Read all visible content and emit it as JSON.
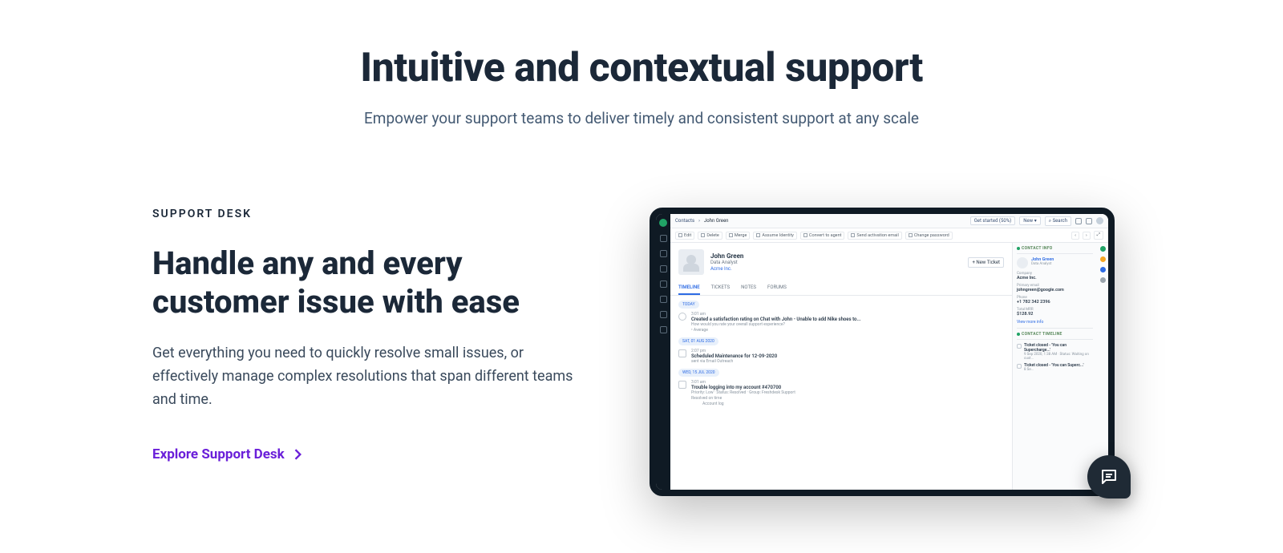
{
  "hero": {
    "title": "Intuitive and contextual support",
    "subtitle": "Empower your support teams to deliver timely and consistent support at any scale"
  },
  "section": {
    "eyebrow": "SUPPORT DESK",
    "heading": "Handle any and every customer issue with ease",
    "body": "Get everything you need to quickly resolve small issues, or effectively manage complex resolutions that span different teams and time.",
    "cta_label": "Explore Support Desk"
  },
  "app": {
    "breadcrumb": {
      "root": "Contacts",
      "current": "John Green"
    },
    "topbar": {
      "get_started": "Get started (50%)",
      "new_btn": "New",
      "search": "Search"
    },
    "actions": [
      "Edit",
      "Delete",
      "Merge",
      "Assume Identity",
      "Convert to agent",
      "Send activation email",
      "Change password"
    ],
    "profile": {
      "name": "John Green",
      "role": "Data Analyst",
      "company": "Acme Inc.",
      "new_ticket_btn": "+ New Ticket"
    },
    "tabs": [
      "TIMELINE",
      "TICKETS",
      "NOTES",
      "FORUMS"
    ],
    "feed": [
      {
        "date": "TODAY",
        "items": [
          {
            "time": "3:01 am",
            "title": "Created a satisfaction rating on Chat with John - Unable to add Nike shoes to...",
            "sub": "How would you rate your overall support experience?",
            "meta": "• Average"
          }
        ]
      },
      {
        "date": "SAT, 01 AUG 2020",
        "items": [
          {
            "time": "2:07 pm",
            "title": "Scheduled Maintenance for 12-09-2020",
            "sub": "sent via Email Outreach"
          }
        ]
      },
      {
        "date": "WED, 15 JUL 2020",
        "items": [
          {
            "time": "3:01 am",
            "title": "Trouble logging into my account #470700",
            "sub": "Priority: Low · Status: Resolved · Group: Freshdesk Support",
            "meta": "Resolved on time",
            "extra": "Account log"
          }
        ]
      }
    ],
    "contact_info": {
      "title": "CONTACT INFO",
      "name": "John Green",
      "role": "Data Analyst",
      "company_label": "Company",
      "company": "Acme Inc.",
      "email_label": "Primary email",
      "email": "johngreen@google.com",
      "phone_label": "Phone",
      "phone": "+1 782 342 2396",
      "mrr_label": "Total MRR",
      "mrr": "$128.92",
      "view_more": "View more info"
    },
    "contact_timeline": {
      "title": "CONTACT TIMELINE",
      "items": [
        {
          "title": "Ticket closed - 'You can Supercharge...'",
          "sub": "9 Sep 2020, 1:38 AM · Status: Waiting on cust..."
        },
        {
          "title": "Ticket closed - 'You can Superc...'",
          "sub": "8 Se..."
        }
      ]
    }
  }
}
